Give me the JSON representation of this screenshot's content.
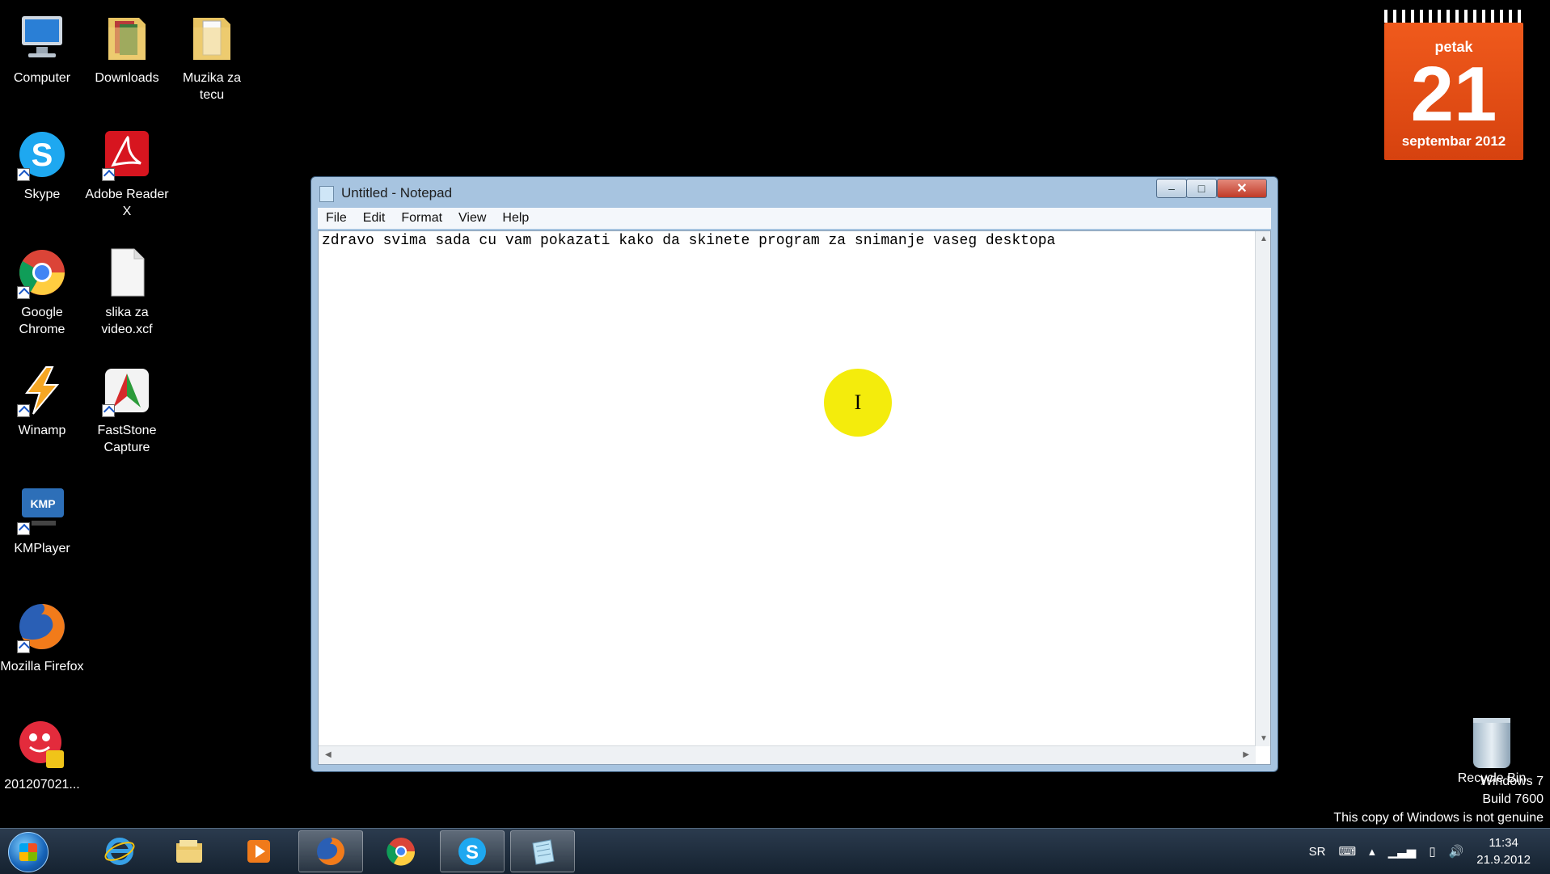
{
  "desktop": {
    "icons": [
      {
        "label": "Computer",
        "icon": "computer-icon"
      },
      {
        "label": "Downloads",
        "icon": "folder-icon"
      },
      {
        "label": "Muzika za tecu",
        "icon": "folder-icon"
      },
      {
        "label": "Skype",
        "icon": "skype-icon"
      },
      {
        "label": "Adobe Reader X",
        "icon": "adobe-reader-icon"
      },
      {
        "label": "Google Chrome",
        "icon": "chrome-icon"
      },
      {
        "label": "slika za video.xcf",
        "icon": "file-icon"
      },
      {
        "label": "Winamp",
        "icon": "winamp-icon"
      },
      {
        "label": "FastStone Capture",
        "icon": "faststone-icon"
      },
      {
        "label": "KMPlayer",
        "icon": "kmplayer-icon"
      },
      {
        "label": "Mozilla Firefox",
        "icon": "firefox-icon"
      },
      {
        "label": "201207021...",
        "icon": "video-file-icon"
      }
    ],
    "recycle_bin_label": "Recycle Bin"
  },
  "calendar": {
    "day_name": "petak",
    "day_number": "21",
    "month_year": "septembar 2012"
  },
  "notepad": {
    "title": "Untitled - Notepad",
    "menu": [
      "File",
      "Edit",
      "Format",
      "View",
      "Help"
    ],
    "text": "zdravo svima sada cu vam pokazati kako da skinete program za snimanje vaseg desktopa",
    "cursor_glyph": "I"
  },
  "watermark": {
    "line1": "Windows 7",
    "line2": "Build 7600",
    "line3": "This copy of Windows is not genuine"
  },
  "taskbar": {
    "language": "SR",
    "time": "11:34",
    "date": "21.9.2012",
    "pinned": [
      "internet-explorer-icon",
      "explorer-icon",
      "media-player-icon",
      "firefox-icon",
      "chrome-icon",
      "skype-icon",
      "notepad-icon"
    ]
  },
  "colors": {
    "calendar_orange": "#e24e14",
    "cursor_highlight": "#f4ec0c",
    "close_button_red": "#c13a27"
  }
}
